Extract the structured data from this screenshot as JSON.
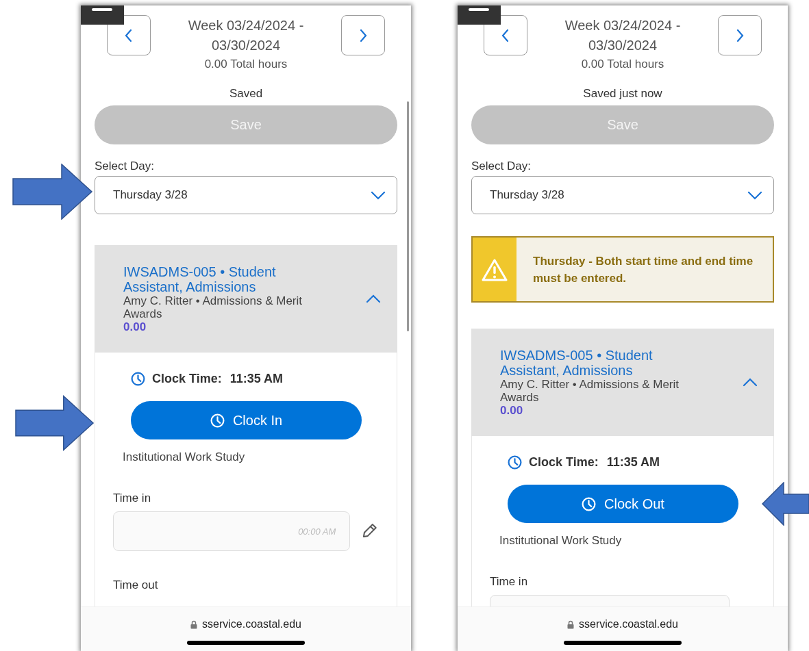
{
  "screens": [
    {
      "header": {
        "title": "Week 03/24/2024 - 03/30/2024",
        "total": "0.00 Total hours"
      },
      "save_status": "Saved",
      "save_button": {
        "label": "Save",
        "disabled": true
      },
      "select_day": {
        "label": "Select Day:",
        "value": "Thursday 3/28"
      },
      "show_scrollbar": true,
      "job": {
        "title": "IWSADMS-005 • Student Assistant, Admissions",
        "subtitle": "Amy C. Ritter • Admissions & Merit Awards",
        "hours": "0.00",
        "expanded": true
      },
      "clock_time": {
        "label": "Clock Time:",
        "value": "11:35 AM"
      },
      "clock_button": {
        "label": "Clock In"
      },
      "program": "Institutional Work Study",
      "fields": [
        {
          "label": "Time in",
          "placeholder": "00:00 AM",
          "editable": true
        },
        {
          "label": "Time out"
        }
      ],
      "url": "sservice.coastal.edu"
    },
    {
      "header": {
        "title": "Week 03/24/2024 - 03/30/2024",
        "total": "0.00 Total hours"
      },
      "save_status": "Saved just now",
      "save_button": {
        "label": "Save",
        "disabled": true
      },
      "select_day": {
        "label": "Select Day:",
        "value": "Thursday 3/28"
      },
      "show_scrollbar": false,
      "alert": {
        "text": "Thursday - Both start time and end time must be entered."
      },
      "job": {
        "title": "IWSADMS-005 • Student Assistant, Admissions",
        "subtitle": "Amy C. Ritter • Admissions & Merit Awards",
        "hours": "0.00",
        "expanded": true
      },
      "clock_time": {
        "label": "Clock Time:",
        "value": "11:35 AM"
      },
      "clock_button": {
        "label": "Clock Out"
      },
      "program": "Institutional Work Study",
      "fields": [
        {
          "label": "Time in",
          "partial": true
        }
      ],
      "url": "sservice.coastal.edu"
    }
  ]
}
